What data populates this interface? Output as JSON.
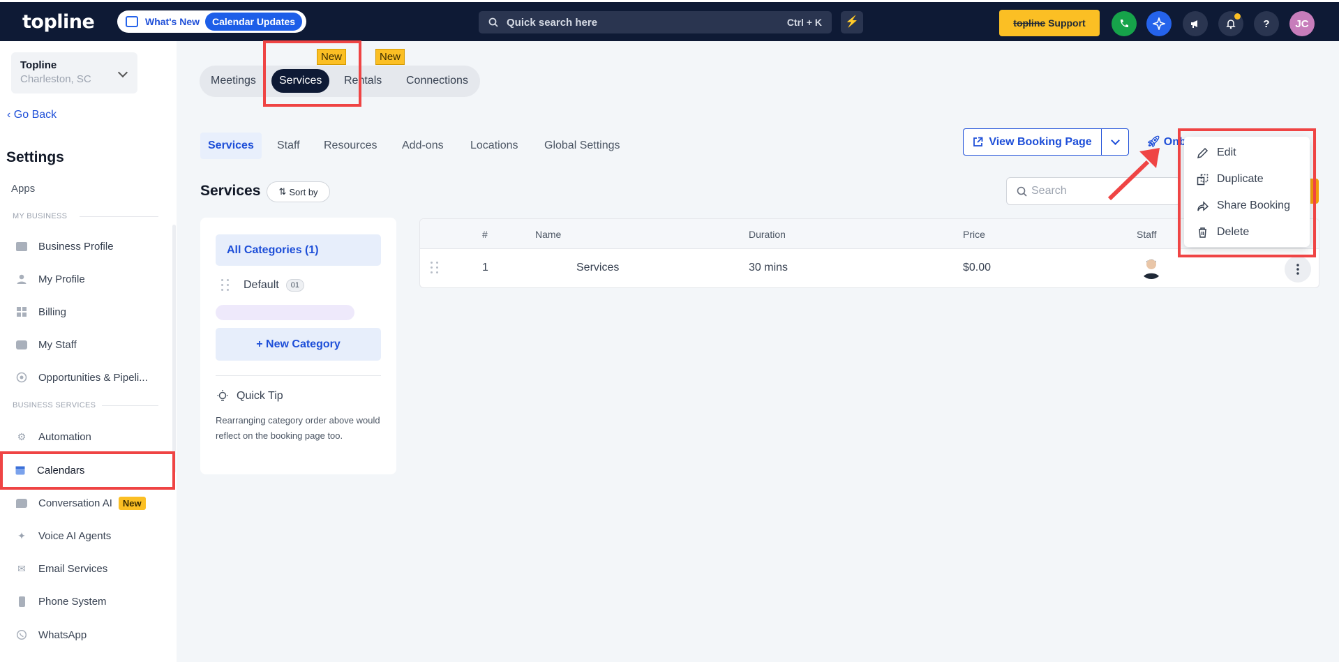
{
  "topbar": {
    "logo": "topline",
    "whats_new": "What's New",
    "calendar_updates": "Calendar Updates",
    "search_placeholder": "Quick search here",
    "search_shortcut": "Ctrl + K",
    "support_brand": "topline",
    "support_label": "Support",
    "user_initials": "JC"
  },
  "sidebar": {
    "business_name": "Topline",
    "business_location": "Charleston, SC",
    "go_back": "Go Back",
    "settings_title": "Settings",
    "apps_label": "Apps",
    "section_my_business": "MY BUSINESS",
    "section_business_services": "BUSINESS SERVICES",
    "items": [
      {
        "label": "Business Profile",
        "icon": "briefcase-icon"
      },
      {
        "label": "My Profile",
        "icon": "user-icon"
      },
      {
        "label": "Billing",
        "icon": "grid-icon"
      },
      {
        "label": "My Staff",
        "icon": "inbox-icon"
      },
      {
        "label": "Opportunities & Pipeli...",
        "icon": "target-icon"
      },
      {
        "label": "Automation",
        "icon": "gears-icon"
      },
      {
        "label": "Calendars",
        "icon": "calendar-icon"
      },
      {
        "label": "Conversation AI",
        "icon": "chat-icon",
        "badge": "New"
      },
      {
        "label": "Voice AI Agents",
        "icon": "sparkle-icon"
      },
      {
        "label": "Email Services",
        "icon": "mail-icon"
      },
      {
        "label": "Phone System",
        "icon": "phone-device-icon"
      },
      {
        "label": "WhatsApp",
        "icon": "whatsapp-icon"
      }
    ]
  },
  "top_tabs": {
    "tabs": [
      "Meetings",
      "Services",
      "Rentals",
      "Connections"
    ],
    "active": "Services",
    "new_badge": "New"
  },
  "sub_tabs": {
    "tabs": [
      "Services",
      "Staff",
      "Resources",
      "Add-ons",
      "Locations",
      "Global Settings"
    ],
    "active": "Services"
  },
  "actions": {
    "view_booking_page": "View Booking Page",
    "onboarding_partial": "Onb"
  },
  "services_header": {
    "title": "Services",
    "sort_by": "Sort by",
    "search_placeholder": "Search"
  },
  "categories": {
    "all": "All Categories (1)",
    "default_label": "Default",
    "default_count": "01",
    "new_category": "New Category",
    "tip_title": "Quick Tip",
    "tip_body": "Rearranging category order above would reflect on the booking page too."
  },
  "table": {
    "headers": [
      "#",
      "Name",
      "Duration",
      "Price",
      "Staff"
    ],
    "rows": [
      {
        "num": "1",
        "name": "Services",
        "duration": "30 mins",
        "price": "$0.00"
      }
    ]
  },
  "context_menu": {
    "items": [
      "Edit",
      "Duplicate",
      "Share Booking",
      "Delete"
    ]
  },
  "colors": {
    "navy": "#0e1a35",
    "accent_blue": "#1d4ed8",
    "highlight_red": "#ef4444",
    "badge_yellow": "#fbbf24"
  }
}
